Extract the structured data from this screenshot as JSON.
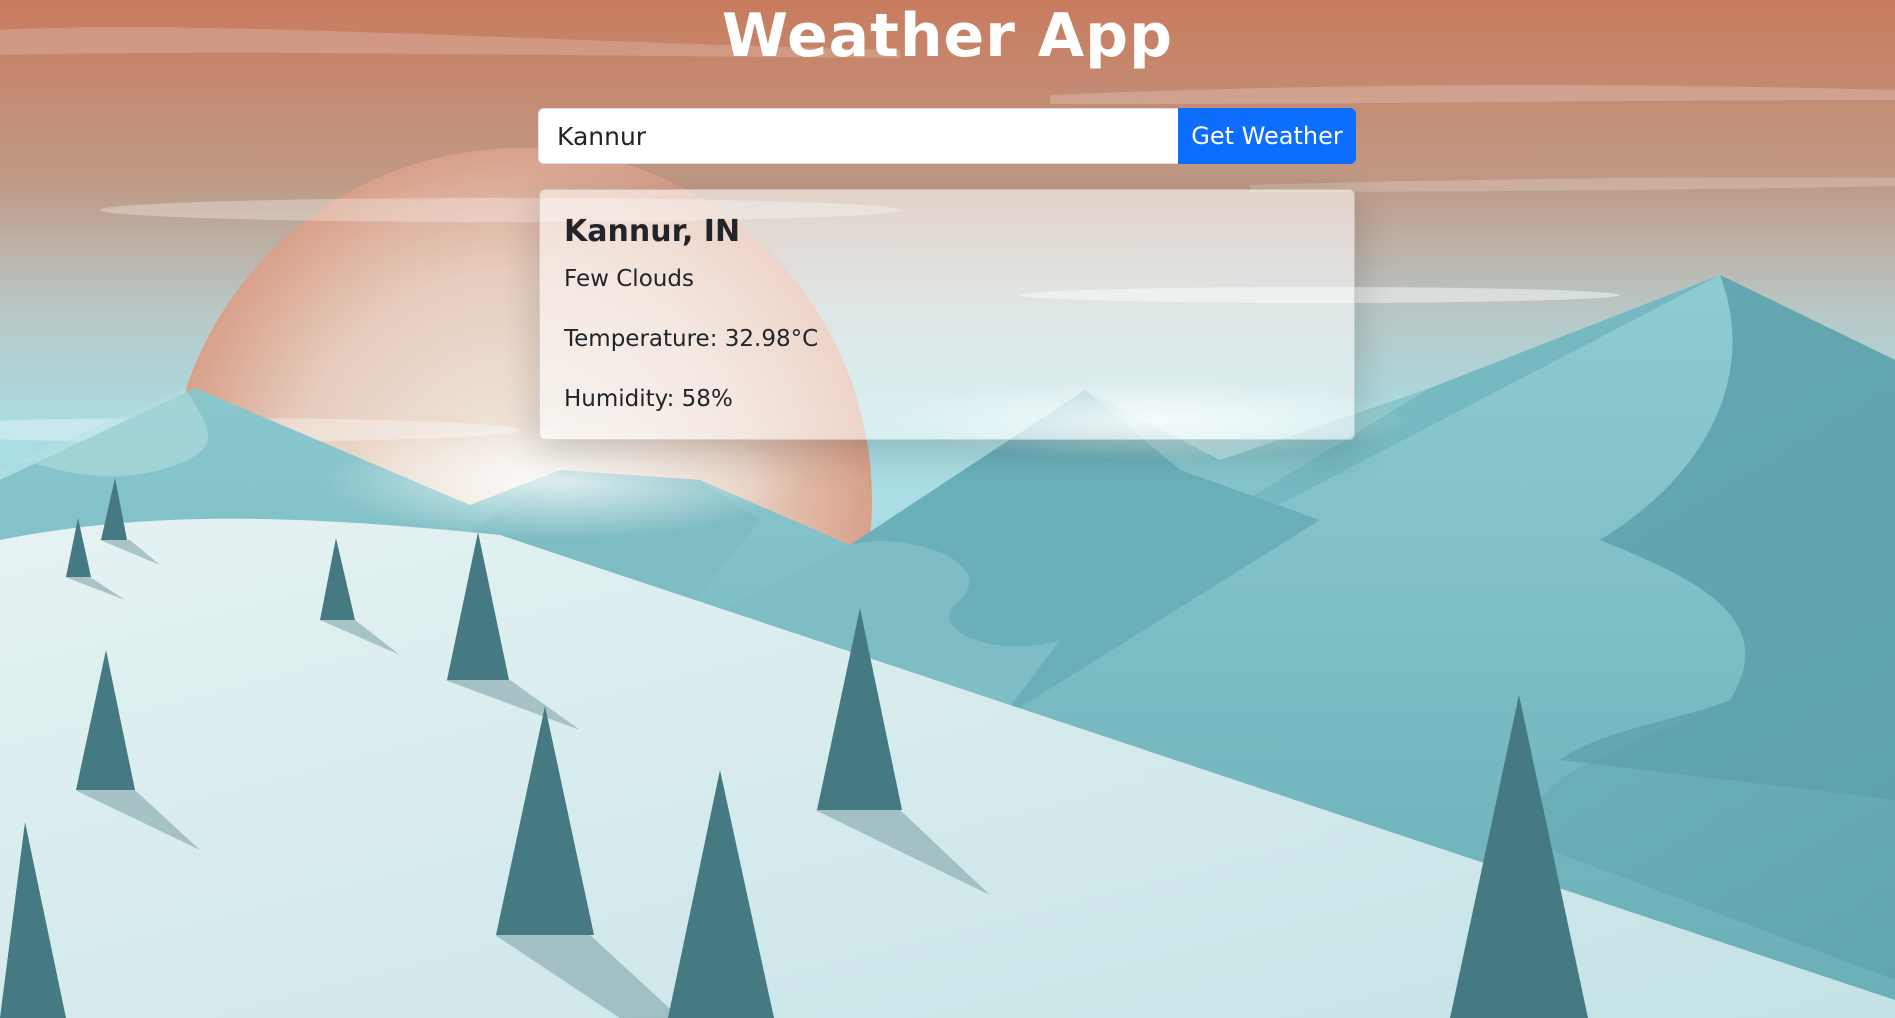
{
  "header": {
    "title": "Weather App"
  },
  "search": {
    "value": "Kannur",
    "button_label": "Get Weather"
  },
  "weather": {
    "location": "Kannur, IN",
    "description": "Few Clouds",
    "temperature": "Temperature: 32.98°C",
    "humidity": "Humidity: 58%"
  },
  "colors": {
    "primary_button": "#0d6efd",
    "sky_top": "#c97b5e",
    "sky_bottom": "#a9dde3",
    "mountain": "#6fb5bd",
    "snow": "#d8ecee",
    "tree": "#467a82"
  }
}
